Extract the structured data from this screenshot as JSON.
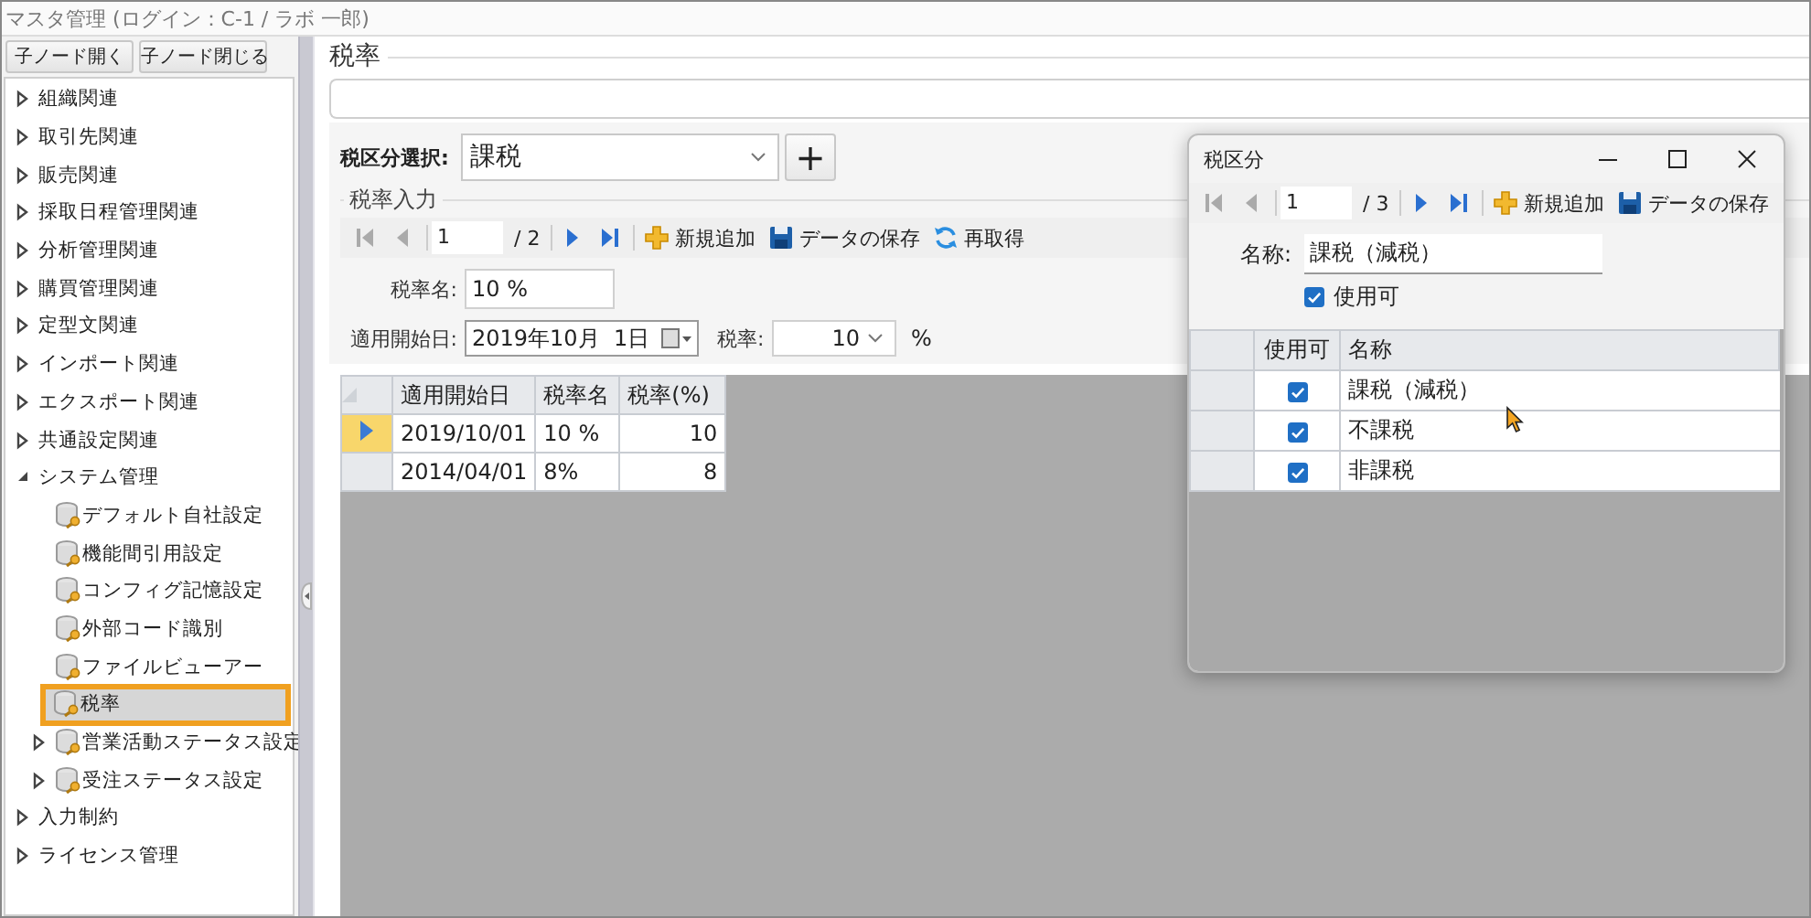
{
  "window": {
    "title": "マスタ管理 (ログイン：C-1 / ラボ 一郎)"
  },
  "sidebar": {
    "buttons": [
      "子ノード開く",
      "子ノード閉じる"
    ],
    "tree": [
      {
        "label": "組織関連",
        "expanded": false,
        "selected": false
      },
      {
        "label": "取引先関連",
        "expanded": false,
        "selected": false
      },
      {
        "label": "販売関連",
        "expanded": false,
        "selected": false
      },
      {
        "label": "採取日程管理関連",
        "expanded": false,
        "selected": false
      },
      {
        "label": "分析管理関連",
        "expanded": false,
        "selected": false
      },
      {
        "label": "購買管理関連",
        "expanded": false,
        "selected": false
      },
      {
        "label": "定型文関連",
        "expanded": false,
        "selected": false
      },
      {
        "label": "インポート関連",
        "expanded": false,
        "selected": false
      },
      {
        "label": "エクスポート関連",
        "expanded": false,
        "selected": false
      },
      {
        "label": "共通設定関連",
        "expanded": false,
        "selected": false
      },
      {
        "label": "システム管理",
        "expanded": true,
        "selected": false,
        "children": [
          {
            "label": "デフォルト自社設定",
            "kind": "leaf",
            "selected": false
          },
          {
            "label": "機能間引用設定",
            "kind": "leaf",
            "selected": false
          },
          {
            "label": "コンフィグ記憶設定",
            "kind": "leaf",
            "selected": false
          },
          {
            "label": "外部コード識別",
            "kind": "leaf",
            "selected": false
          },
          {
            "label": "ファイルビューアー",
            "kind": "leaf",
            "selected": false
          },
          {
            "label": "税率",
            "kind": "leaf",
            "selected": true
          },
          {
            "label": "営業活動ステータス設定",
            "kind": "node",
            "expanded": false,
            "selected": false
          },
          {
            "label": "受注ステータス設定",
            "kind": "node",
            "expanded": false,
            "selected": false
          }
        ]
      },
      {
        "label": "入力制約",
        "expanded": false,
        "selected": false
      },
      {
        "label": "ライセンス管理",
        "expanded": false,
        "selected": false
      }
    ]
  },
  "main": {
    "title": "税率",
    "tax_class": {
      "label": "税区分選択:",
      "value": "課税",
      "add_button": "+"
    },
    "rate_input": {
      "title": "税率入力",
      "pager": {
        "page": "1",
        "total": "/ 2"
      },
      "toolbar": [
        {
          "label": "新規追加",
          "kind": "add"
        },
        {
          "label": "データの保存",
          "kind": "save"
        },
        {
          "label": "再取得",
          "kind": "refresh"
        }
      ],
      "rate_name": {
        "label": "税率名:",
        "value": "10 %"
      },
      "start_date": {
        "label": "適用開始日:",
        "value": "2019年10月  1日"
      },
      "rate": {
        "label": "税率:",
        "value": "10",
        "unit": "%"
      }
    },
    "grid": {
      "columns": [
        "適用開始日",
        "税率名",
        "税率(%)"
      ],
      "rows": [
        {
          "cells": [
            "2019/10/01",
            "10 %",
            "10"
          ],
          "selected": true
        },
        {
          "cells": [
            "2014/04/01",
            "8%",
            "8"
          ],
          "selected": false
        }
      ]
    }
  },
  "dialog": {
    "title": "税区分",
    "pager": {
      "page": "1",
      "total": "/ 3"
    },
    "toolbar": [
      {
        "label": "新規追加",
        "kind": "add"
      },
      {
        "label": "データの保存",
        "kind": "save"
      }
    ],
    "name_field": {
      "label": "名称:",
      "value": "課税（減税）"
    },
    "enabled": {
      "label": "使用可",
      "checked": true
    },
    "grid": {
      "columns": [
        "使用可",
        "名称"
      ],
      "rows": [
        {
          "checked": true,
          "name": "課税（減税）"
        },
        {
          "checked": true,
          "name": "不課税"
        },
        {
          "checked": true,
          "name": "非課税"
        }
      ]
    }
  }
}
